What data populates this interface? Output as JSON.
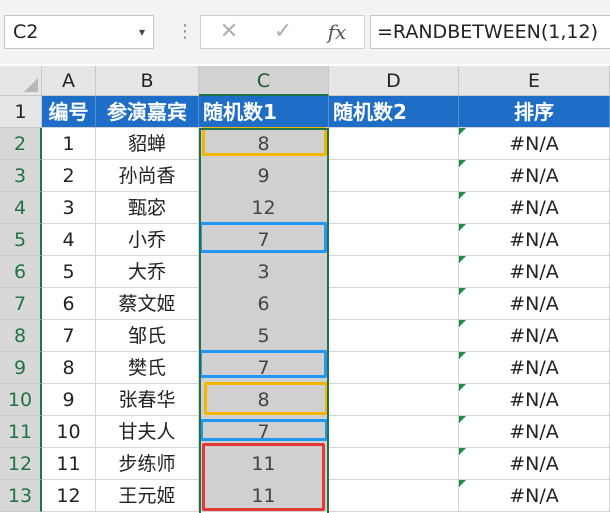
{
  "formula_bar": {
    "name_box": "C2",
    "name_box_arrow": "▾",
    "dots": "⋮",
    "cancel_glyph": "✕",
    "enter_glyph": "✓",
    "fx_glyph": "fx",
    "formula": "=RANDBETWEEN(1,12)"
  },
  "columns": [
    "A",
    "B",
    "C",
    "D",
    "E"
  ],
  "header": {
    "a": "编号",
    "b": "参演嘉宾",
    "c": "随机数1",
    "d": "随机数2",
    "e": "排序"
  },
  "row_numbers": [
    "1",
    "2",
    "3",
    "4",
    "5",
    "6",
    "7",
    "8",
    "9",
    "10",
    "11",
    "12",
    "13"
  ],
  "rows": [
    {
      "a": "1",
      "b": "貂蝉",
      "c": "8",
      "d": "",
      "e": "#N/A"
    },
    {
      "a": "2",
      "b": "孙尚香",
      "c": "9",
      "d": "",
      "e": "#N/A"
    },
    {
      "a": "3",
      "b": "甄宓",
      "c": "12",
      "d": "",
      "e": "#N/A"
    },
    {
      "a": "4",
      "b": "小乔",
      "c": "7",
      "d": "",
      "e": "#N/A"
    },
    {
      "a": "5",
      "b": "大乔",
      "c": "3",
      "d": "",
      "e": "#N/A"
    },
    {
      "a": "6",
      "b": "蔡文姬",
      "c": "6",
      "d": "",
      "e": "#N/A"
    },
    {
      "a": "7",
      "b": "邹氏",
      "c": "5",
      "d": "",
      "e": "#N/A"
    },
    {
      "a": "8",
      "b": "樊氏",
      "c": "7",
      "d": "",
      "e": "#N/A"
    },
    {
      "a": "9",
      "b": "张春华",
      "c": "8",
      "d": "",
      "e": "#N/A"
    },
    {
      "a": "10",
      "b": "甘夫人",
      "c": "7",
      "d": "",
      "e": "#N/A"
    },
    {
      "a": "11",
      "b": "步练师",
      "c": "11",
      "d": "",
      "e": "#N/A"
    },
    {
      "a": "12",
      "b": "王元姬",
      "c": "11",
      "d": "",
      "e": "#N/A"
    }
  ],
  "colors": {
    "header_fill": "#1e6ec8",
    "highlight_orange": "#f5b400",
    "highlight_blue": "#2196f3",
    "highlight_red": "#e53935",
    "selection_green": "#217346"
  }
}
